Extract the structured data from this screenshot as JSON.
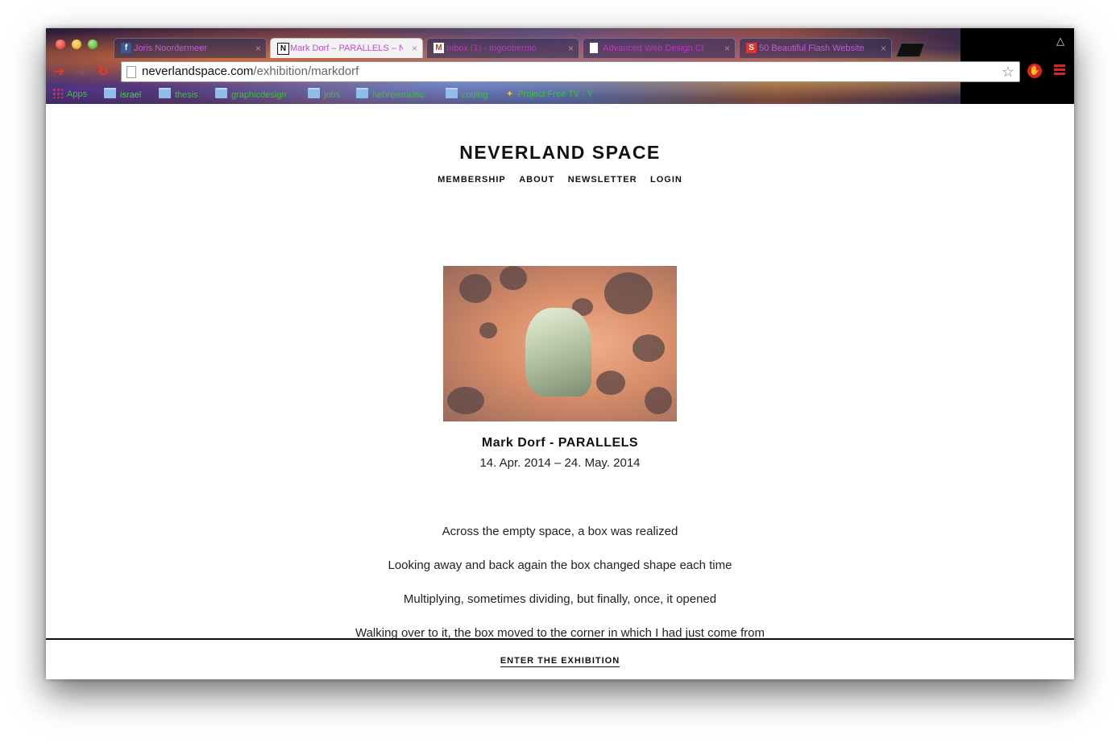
{
  "browser": {
    "tabs": [
      {
        "label": "Joris Noordermeer",
        "favicon": "f",
        "favicon_name": "facebook-icon",
        "favicon_color": "#3b5998",
        "active": false
      },
      {
        "label": "Mark Dorf – PARALLELS – N",
        "favicon": "N",
        "favicon_name": "neverland-icon",
        "favicon_color": "#111111",
        "active": true
      },
      {
        "label": "Inbox (1) - mgoobermo",
        "favicon": "M",
        "favicon_name": "gmail-icon",
        "favicon_color": "#d93025",
        "active": false
      },
      {
        "label": "Advanced Web Design Cl",
        "favicon": "",
        "favicon_name": "document-icon",
        "favicon_color": "#ffffff",
        "active": false
      },
      {
        "label": "50 Beautiful Flash Website",
        "favicon": "S",
        "favicon_name": "smashing-icon",
        "favicon_color": "#e8322d",
        "active": false
      }
    ],
    "tab_close": "×",
    "address": {
      "host": "neverlandspace.com",
      "path": "/exhibition/markdorf"
    },
    "bookmarks": [
      {
        "label": "Apps",
        "type": "apps"
      },
      {
        "label": "israel",
        "type": "folder"
      },
      {
        "label": "thesis",
        "type": "folder"
      },
      {
        "label": "graphicdesign",
        "type": "folder"
      },
      {
        "label": "jobs",
        "type": "folder"
      },
      {
        "label": "hebrewmusic",
        "type": "folder"
      },
      {
        "label": "coding",
        "type": "folder"
      },
      {
        "label": "Project Free TV - Y",
        "type": "link"
      }
    ]
  },
  "site": {
    "title": "NEVERLAND SPACE",
    "nav": [
      "MEMBERSHIP",
      "ABOUT",
      "NEWSLETTER",
      "LOGIN"
    ]
  },
  "exhibition": {
    "title": "Mark Dorf - PARALLELS",
    "dates": "14. Apr. 2014 – 24. May. 2014",
    "lines": [
      "Across the empty space, a box was realized",
      "Looking away and back again the box changed shape each time",
      "Multiplying, sometimes dividing, but finally, once, it opened",
      "Walking over to it, the box moved to the corner in which I had just come from"
    ],
    "enter_label": "ENTER THE EXHIBITION"
  }
}
